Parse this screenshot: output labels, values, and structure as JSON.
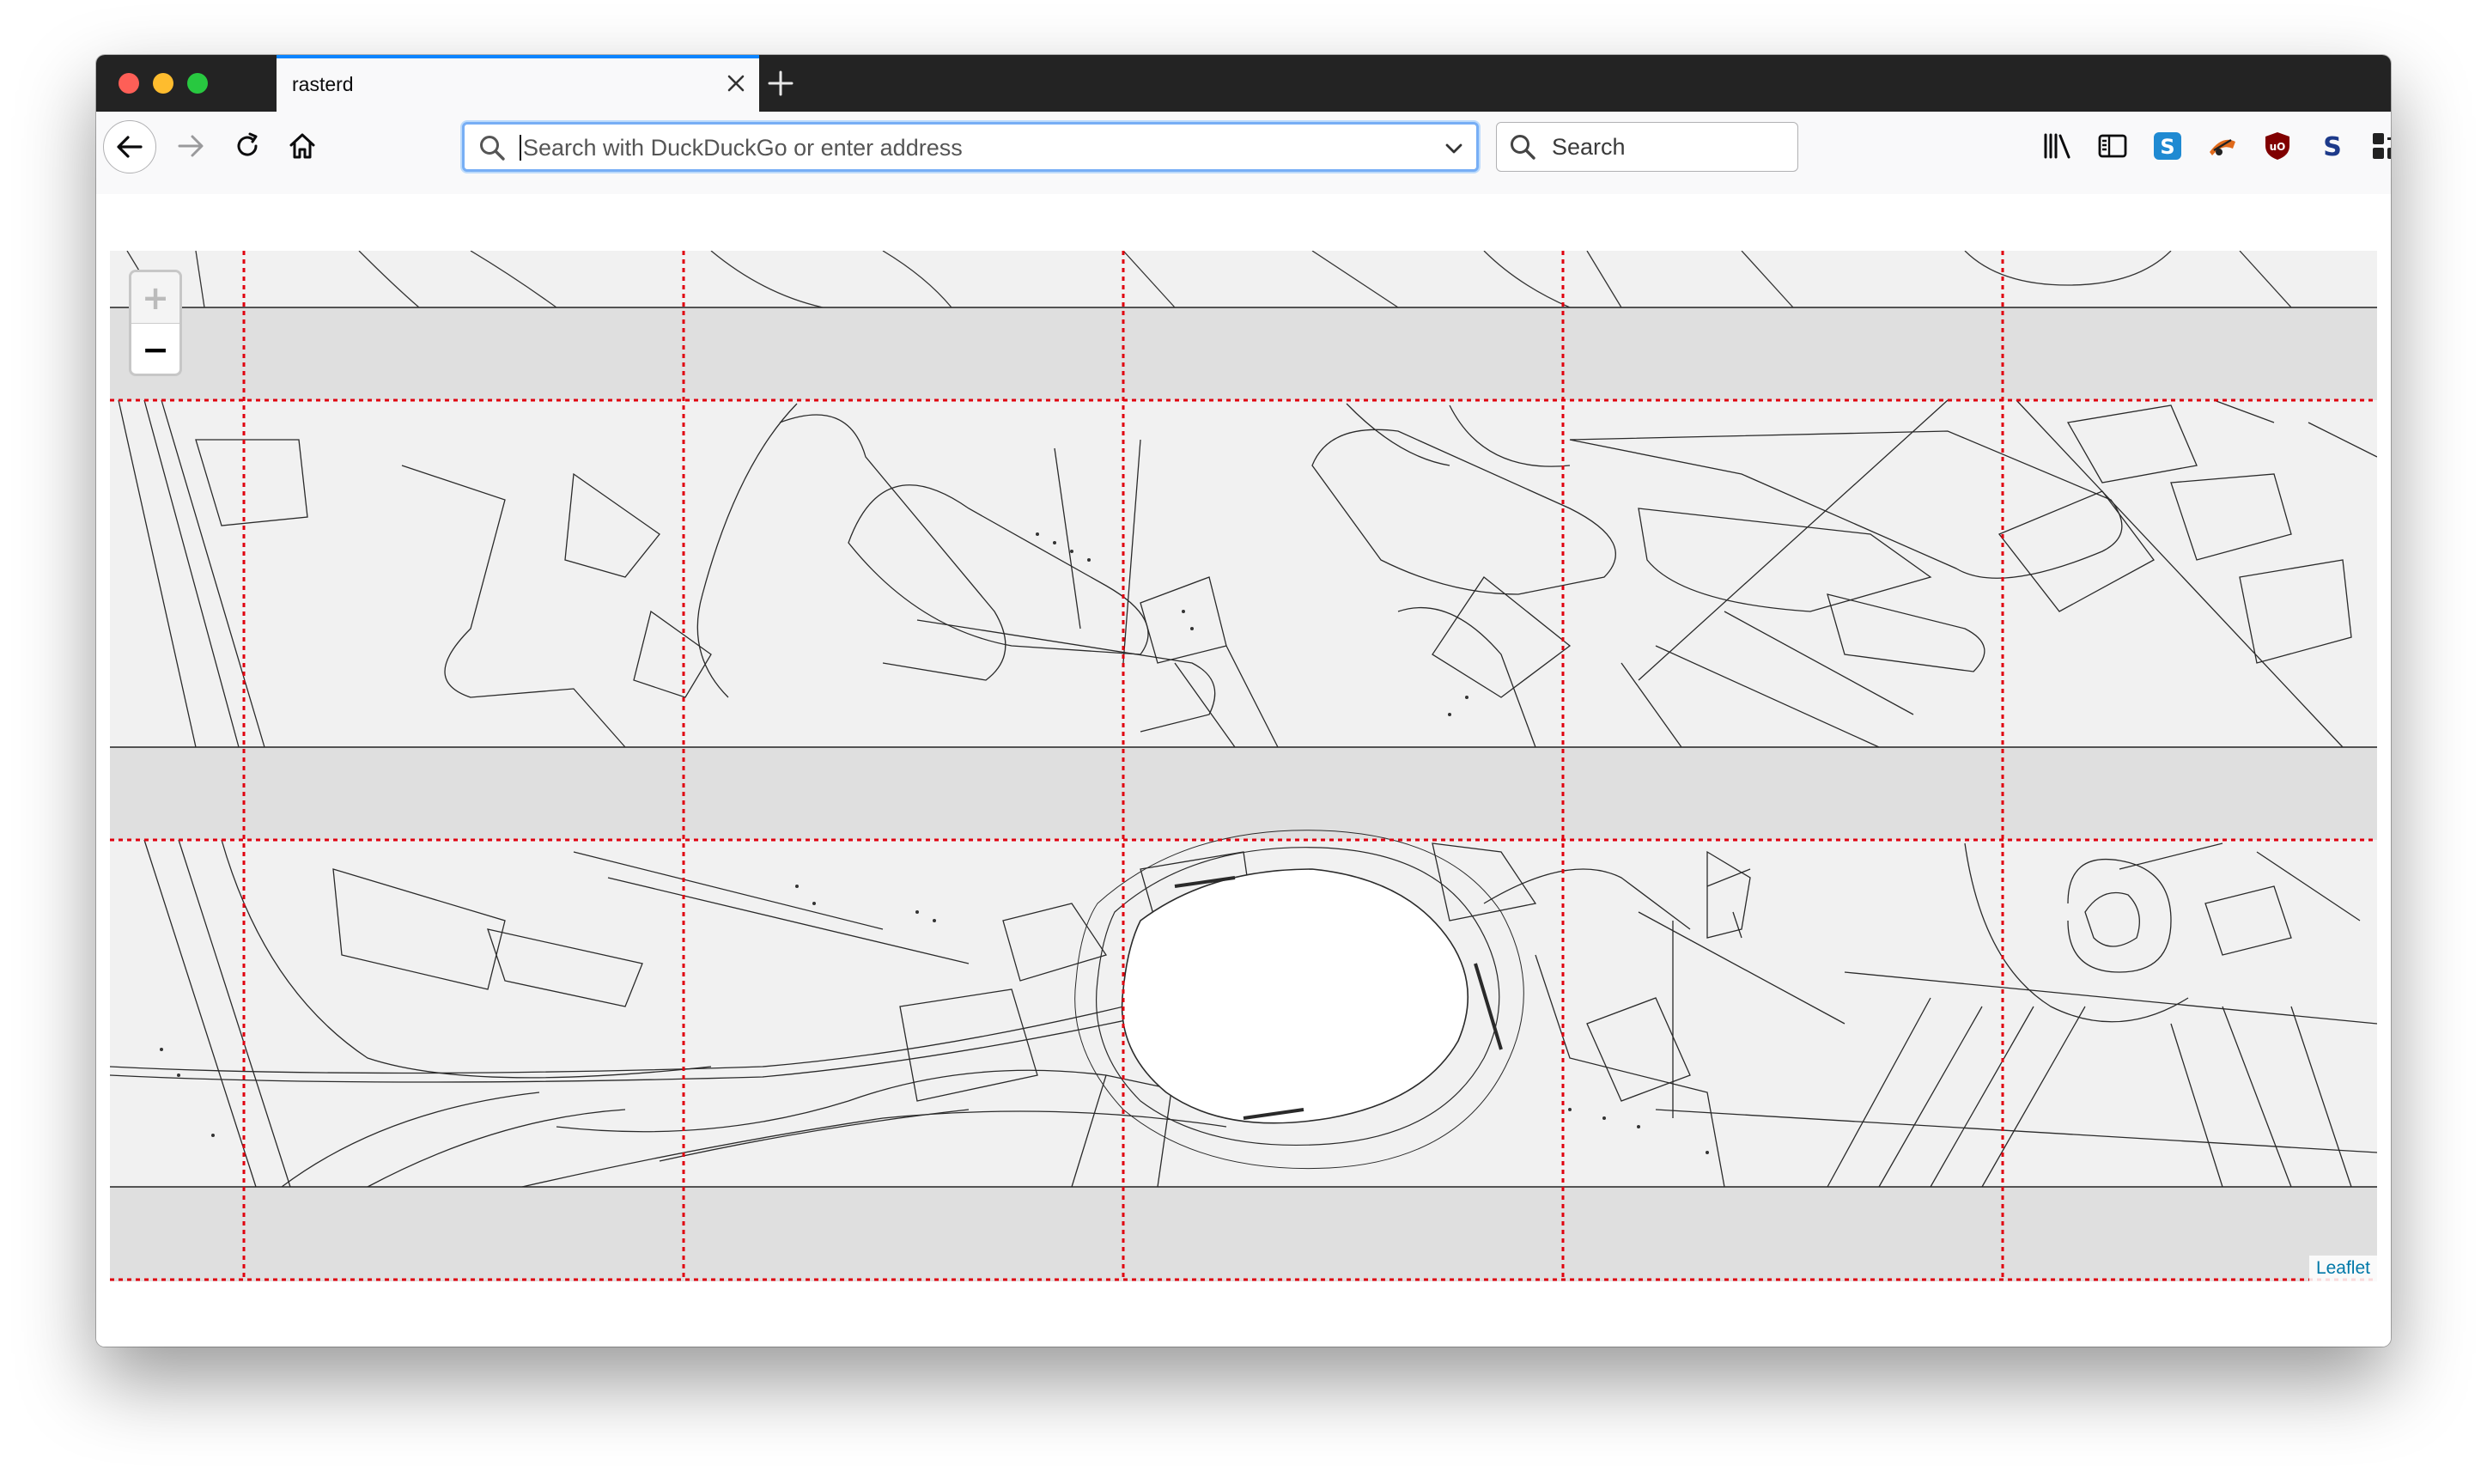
{
  "browser": {
    "tab": {
      "title": "rasterd"
    },
    "urlbar": {
      "placeholder": "Search with DuckDuckGo or enter address",
      "value": ""
    },
    "searchbar": {
      "placeholder": "Search"
    },
    "toolbar_icons": [
      "library-icon",
      "sidebar-icon",
      "simplenote-icon",
      "extension-icon",
      "ublock-origin-icon",
      "s-extension-icon",
      "apps-icon",
      "hamburger-menu-icon"
    ]
  },
  "map": {
    "zoom": {
      "in_label": "+",
      "out_label": "−"
    },
    "attribution": "Leaflet",
    "colors": {
      "tile_grid": "#e0000f",
      "gap": "#dfdfdf",
      "tile": "#f1f1f1",
      "road": "#1a1a1a",
      "attribution_link": "#0078a8"
    }
  }
}
